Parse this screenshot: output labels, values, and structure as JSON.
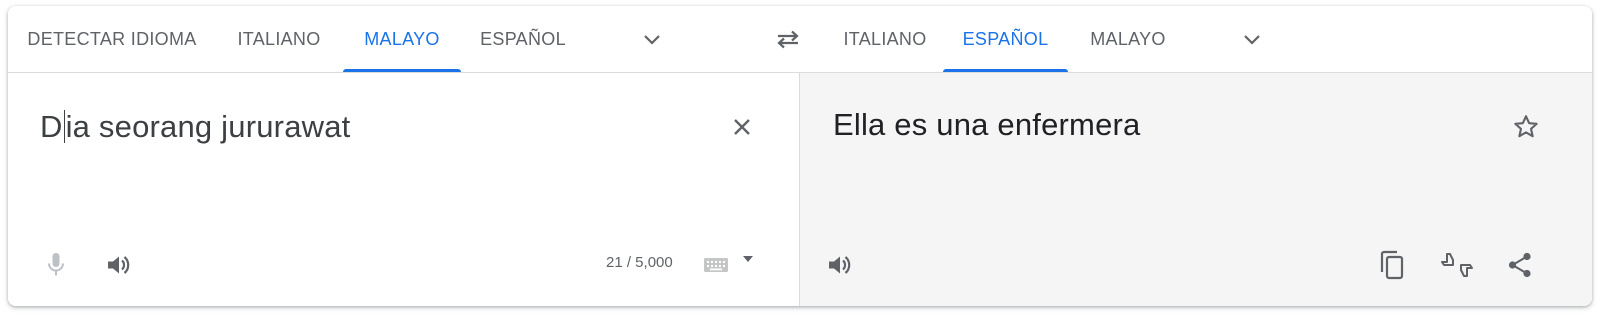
{
  "source_tabs": [
    {
      "label": "DETECTAR IDIOMA",
      "active": false
    },
    {
      "label": "ITALIANO",
      "active": false
    },
    {
      "label": "MALAYO",
      "active": true
    },
    {
      "label": "ESPAÑOL",
      "active": false
    }
  ],
  "target_tabs": [
    {
      "label": "ITALIANO",
      "active": false
    },
    {
      "label": "ESPAÑOL",
      "active": true
    },
    {
      "label": "MALAYO",
      "active": false
    }
  ],
  "source": {
    "text_before_caret": "D",
    "text_after_caret": "ia seorang jururawat",
    "char_count": "21 / 5,000"
  },
  "target": {
    "text": "Ella es una enfermera"
  },
  "icons": {
    "source_more": "chevron-down-icon",
    "swap": "swap-icon",
    "target_more": "chevron-down-icon",
    "clear": "close-icon",
    "mic": "mic-icon",
    "listen_source": "speaker-icon",
    "keyboard": "keyboard-icon",
    "keyboard_menu": "dropdown-arrow-icon",
    "star": "star-icon",
    "listen_target": "speaker-icon",
    "copy": "copy-icon",
    "feedback": "feedback-icon",
    "share": "share-icon"
  },
  "colors": {
    "accent": "#1a73e8",
    "text": "#3c4043",
    "muted": "#5f6368",
    "target_panel_bg": "#f5f5f5"
  }
}
